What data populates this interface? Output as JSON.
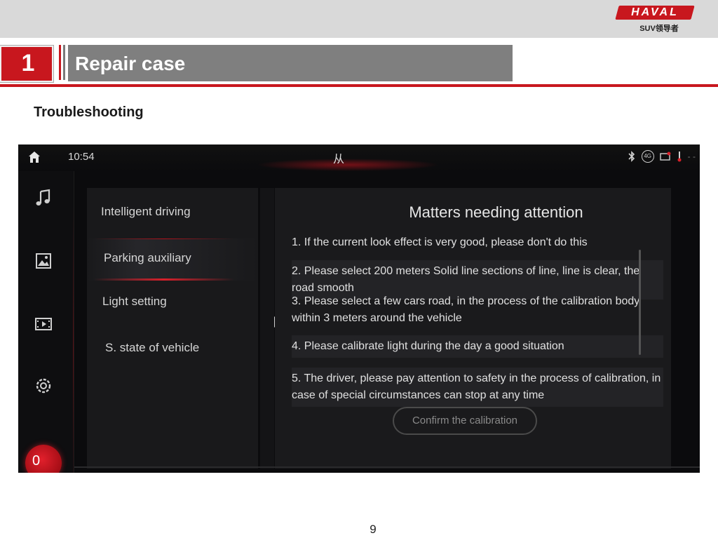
{
  "header": {
    "brand": "HAVAL",
    "brand_sub": "SUV领导者",
    "section_number": "1",
    "title": "Repair case",
    "brand_color": "#c8171e"
  },
  "subtitle": "Troubleshooting",
  "page_number": "9",
  "screen": {
    "status": {
      "time": "10:54",
      "center_glyph": "从",
      "icons": [
        "bluetooth-icon",
        "4g-icon",
        "message-icon",
        "thermometer-icon"
      ],
      "signal_label": "4G"
    },
    "rail": {
      "icons": [
        "home-icon",
        "music-icon",
        "image-icon",
        "video-icon",
        "settings-icon"
      ],
      "record_label": "0"
    },
    "menu": [
      {
        "label": "Intelligent driving"
      },
      {
        "label": "Parking auxiliary"
      },
      {
        "label": "Light setting"
      },
      {
        "label": "S. state of vehicle"
      }
    ],
    "panel": {
      "title": "Matters needing attention",
      "items": [
        "1. If the current look effect is very good, please don't do this",
        "2. Please select 200 meters Solid line sections of line, line is clear, the road smooth",
        "3. Please select a few cars road, in the process of the calibration body within 3 meters around the vehicle",
        "4. Please calibrate light during the day a good situation",
        "5. The driver, please pay attention to safety in the process of calibration, in case of special circumstances can stop at any time"
      ],
      "confirm_label": "Confirm the calibration"
    }
  }
}
